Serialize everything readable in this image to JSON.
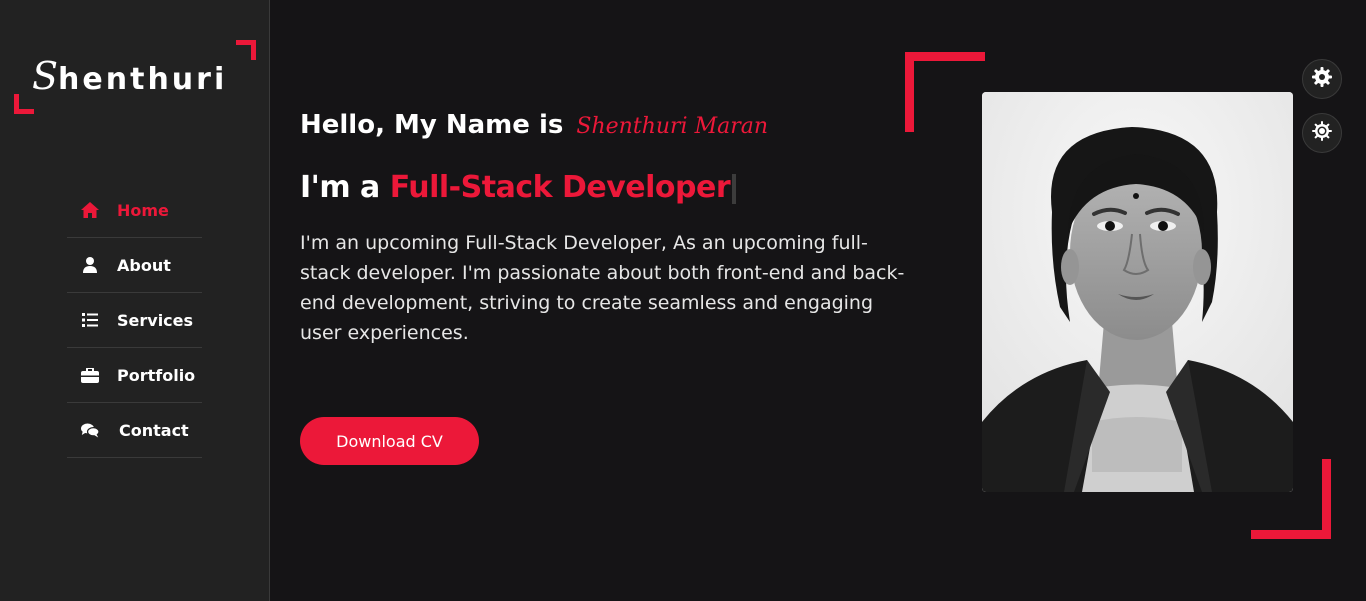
{
  "logo": {
    "initial": "S",
    "rest": "henthuri"
  },
  "nav": {
    "items": [
      {
        "label": "Home",
        "icon": "home-icon",
        "active": true
      },
      {
        "label": "About",
        "icon": "user-icon",
        "active": false
      },
      {
        "label": "Services",
        "icon": "list-icon",
        "active": false
      },
      {
        "label": "Portfolio",
        "icon": "briefcase-icon",
        "active": false
      },
      {
        "label": "Contact",
        "icon": "comments-icon",
        "active": false
      }
    ]
  },
  "hero": {
    "hello_prefix": "Hello, My Name is",
    "name": "Shenthuri Maran",
    "role_prefix": "I'm a",
    "role": "Full-Stack Developer",
    "description": "I'm an upcoming Full-Stack Developer, As an upcoming full-stack developer. I'm passionate about both front-end and back-end development, striving to create seamless and engaging user experiences.",
    "cta": "Download CV"
  },
  "settings": {
    "top_icon": "gear-icon",
    "bottom_icon": "sun-icon"
  },
  "colors": {
    "accent": "#ec1839",
    "background": "#151416",
    "sidebar": "#222222"
  }
}
